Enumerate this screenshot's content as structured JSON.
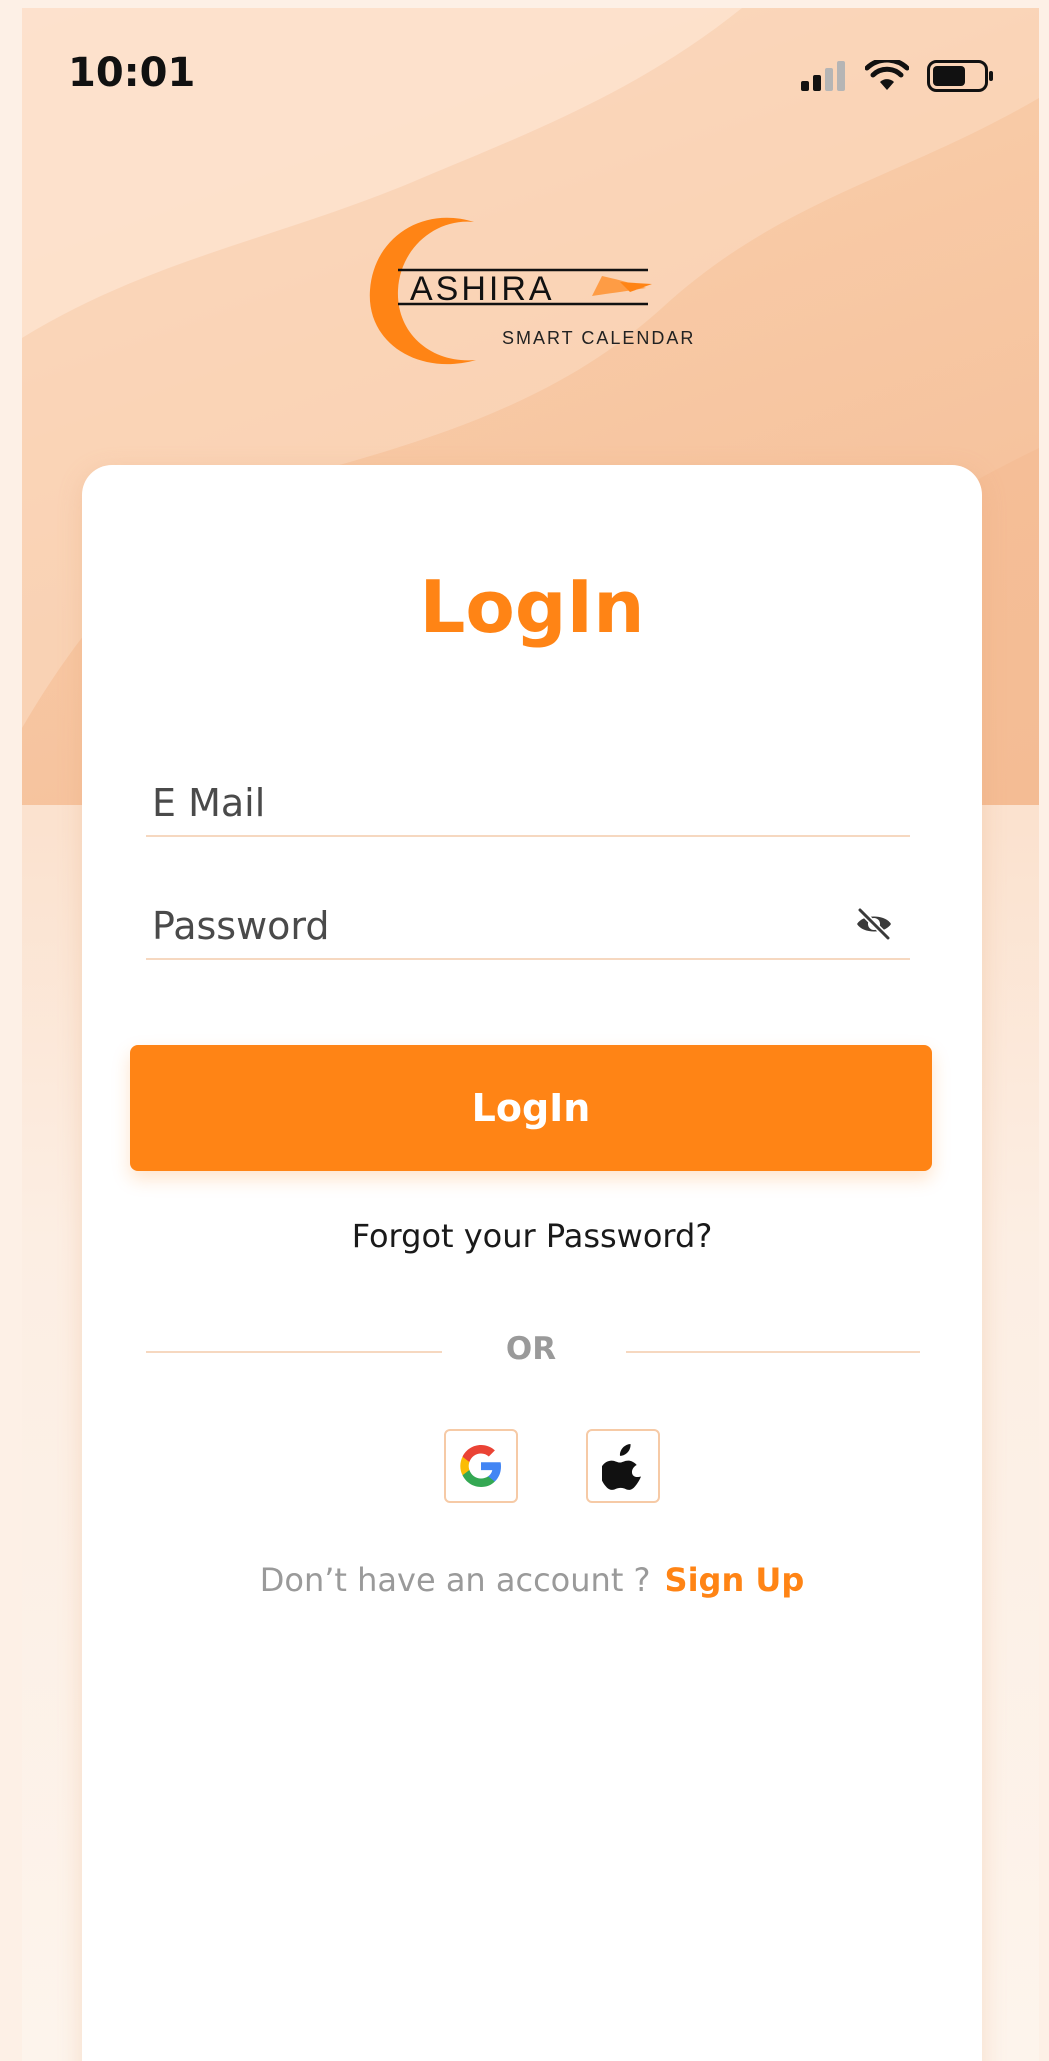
{
  "status_bar": {
    "time": "10:01"
  },
  "logo": {
    "brand": "ASHIRA",
    "tagline": "SMART CALENDAR"
  },
  "login": {
    "title": "LogIn",
    "email_label": "E Mail",
    "password_label": "Password",
    "submit_label": "LogIn",
    "forgot_label": "Forgot your Password?",
    "divider_label": "OR",
    "no_account_text": "Don’t have an account ?",
    "signup_label": "Sign Up"
  },
  "social": {
    "google_icon": "google-g-icon",
    "apple_icon": "apple-logo-icon"
  },
  "colors": {
    "accent": "#ff8415",
    "muted_text": "#9a9a9a",
    "input_underline": "#f6d8c0"
  }
}
